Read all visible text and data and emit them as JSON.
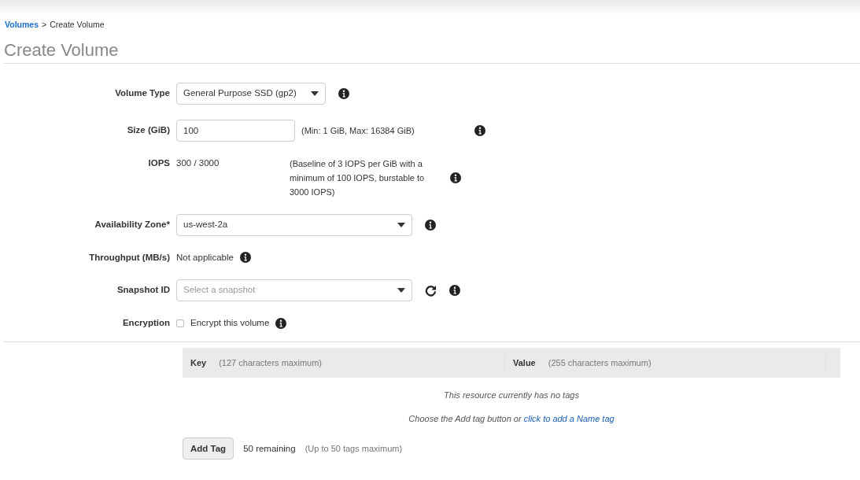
{
  "breadcrumb": {
    "link": "Volumes",
    "separator": ">",
    "current": "Create Volume"
  },
  "title": "Create Volume",
  "fields": [
    {
      "kind": "dropdown",
      "label": "Volume Type",
      "value": "General Purpose SSD (gp2)"
    },
    {
      "kind": "input",
      "label": "Size (GiB)",
      "value": "100",
      "hint": "(Min: 1 GiB, Max: 16384 GiB)"
    },
    {
      "kind": "readout",
      "label": "IOPS",
      "value": "300 / 3000",
      "hint": "(Baseline of 3 IOPS per GiB with a minimum of 100 IOPS, burstable to 3000 IOPS)"
    },
    {
      "kind": "select",
      "label": "Availability Zone*",
      "value": "us-west-2a"
    },
    {
      "kind": "text",
      "label": "Throughput (MB/s)",
      "value": "Not applicable"
    },
    {
      "kind": "select",
      "label": "Snapshot ID",
      "placeholder": "Select a snapshot",
      "refresh": true
    },
    {
      "kind": "checkbox",
      "label": "Encryption",
      "value": "Encrypt this volume",
      "checked": false
    }
  ],
  "tags": {
    "columns": [
      {
        "name": "Key",
        "hint": "(127 characters maximum)"
      },
      {
        "name": "Value",
        "hint": "(255 characters maximum)"
      }
    ],
    "empty": "This resource currently has no tags",
    "prompt": "Choose the Add tag button or",
    "prompt_link": "click to add a Name tag",
    "add_button": "Add Tag",
    "remaining": "50 remaining",
    "limit": "(Up to 50 tags maximum)"
  }
}
